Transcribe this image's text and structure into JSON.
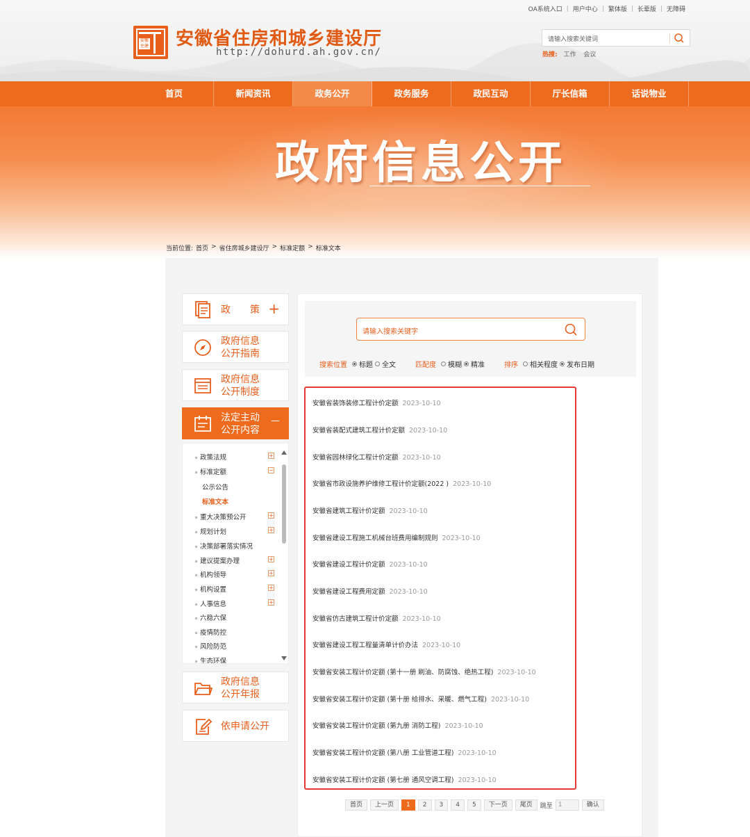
{
  "header": {
    "top_links": [
      "OA系统入口",
      "用户中心",
      "繁体版",
      "长辈版",
      "无障碍"
    ],
    "site_title": "安徽省住房和城乡建设厅",
    "site_url": "http://dohurd.ah.gov.cn/",
    "logo_text": "安徽住建",
    "search_placeholder": "请输入搜索关键词",
    "hot_label": "热搜:",
    "hot_words": [
      "工作",
      "会议"
    ]
  },
  "nav": {
    "items": [
      "首页",
      "新闻资讯",
      "政务公开",
      "政务服务",
      "政民互动",
      "厅长信箱",
      "话说物业"
    ],
    "active_index": 2
  },
  "banner": {
    "title": "政府信息公开"
  },
  "breadcrumb": {
    "label": "当前位置:",
    "items": [
      "首页",
      "省住房城乡建设厅",
      "标准定额",
      "标准文本"
    ],
    "sep": ">"
  },
  "sidebar": {
    "items": [
      {
        "label": "政　　策",
        "icon": "document-icon",
        "plus": "+"
      },
      {
        "label1": "政府信息",
        "label2": "公开指南",
        "icon": "compass-icon"
      },
      {
        "label1": "政府信息",
        "label2": "公开制度",
        "icon": "list-icon"
      },
      {
        "label1": "法定主动",
        "label2": "公开内容",
        "icon": "calendar-icon",
        "plus": "—"
      },
      {
        "label1": "政府信息",
        "label2": "公开年报",
        "icon": "folder-icon"
      },
      {
        "label": "依申请公开",
        "icon": "edit-icon"
      }
    ],
    "tree": [
      {
        "label": "政策法规",
        "pm": "+"
      },
      {
        "label": "标准定额",
        "pm": "−"
      },
      {
        "label": "公示公告",
        "sub": true
      },
      {
        "label": "标准文本",
        "sub": true,
        "current": true
      },
      {
        "label": "重大决策预公开",
        "pm": "+"
      },
      {
        "label": "规划计划",
        "pm": "+"
      },
      {
        "label": "决策部署落实情况"
      },
      {
        "label": "建议提案办理",
        "pm": "+"
      },
      {
        "label": "机构领导",
        "pm": "+"
      },
      {
        "label": "机构设置",
        "pm": "+"
      },
      {
        "label": "人事信息",
        "pm": "+"
      },
      {
        "label": "六稳六保"
      },
      {
        "label": "疫情防控"
      },
      {
        "label": "风险防范"
      },
      {
        "label": "生态环保"
      }
    ]
  },
  "main": {
    "search_placeholder": "请输入搜索关键字",
    "filters": {
      "position_label": "搜索位置",
      "position_options": [
        "标题",
        "全文"
      ],
      "match_label": "匹配度",
      "match_options": [
        "模糊",
        "精准"
      ],
      "sort_label": "排序",
      "sort_options": [
        "相关程度",
        "发布日期"
      ]
    },
    "list": [
      {
        "title": "安徽省装饰装修工程计价定额",
        "date": "2023-10-10"
      },
      {
        "title": "安徽省装配式建筑工程计价定额",
        "date": "2023-10-10"
      },
      {
        "title": "安徽省园林绿化工程计价定额",
        "date": "2023-10-10"
      },
      {
        "title": "安徽省市政设施养护维修工程计价定额(2022 )",
        "date": "2023-10-10"
      },
      {
        "title": "安徽省建筑工程计价定额",
        "date": "2023-10-10"
      },
      {
        "title": "安徽省建设工程施工机械台班费用编制规则",
        "date": "2023-10-10"
      },
      {
        "title": "安徽省建设工程计价定额",
        "date": "2023-10-10"
      },
      {
        "title": "安徽省建设工程费用定额",
        "date": "2023-10-10"
      },
      {
        "title": "安徽省仿古建筑工程计价定额",
        "date": "2023-10-10"
      },
      {
        "title": "安徽省建设工程工程量清单计价办法",
        "date": "2023-10-10"
      },
      {
        "title": "安徽省安装工程计价定额 (第十一册 刷油、防腐蚀、绝热工程)",
        "date": "2023-10-10"
      },
      {
        "title": "安徽省安装工程计价定额 (第十册 给排水、采暖、燃气工程)",
        "date": "2023-10-10"
      },
      {
        "title": "安徽省安装工程计价定额 (第九册 消防工程)",
        "date": "2023-10-10"
      },
      {
        "title": "安徽省安装工程计价定额 (第八册 工业管道工程)",
        "date": "2023-10-10"
      },
      {
        "title": "安徽省安装工程计价定额 (第七册 通风空调工程)",
        "date": "2023-10-10"
      }
    ],
    "pager": {
      "first": "首页",
      "prev": "上一页",
      "pages": [
        "1",
        "2",
        "3",
        "4",
        "5"
      ],
      "current": "1",
      "next": "下一页",
      "last": "尾页",
      "jump_label": "跳至",
      "jump_value": "1",
      "confirm": "确认"
    }
  },
  "colors": {
    "accent": "#ee6a1c",
    "highlight_border": "#e53935"
  }
}
